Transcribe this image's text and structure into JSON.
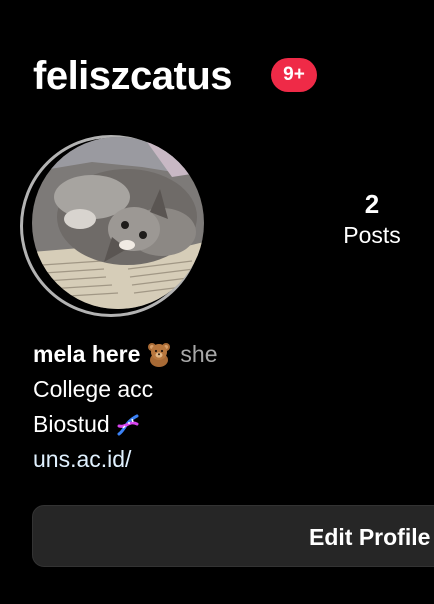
{
  "profile": {
    "username": "feliszcatus",
    "notification_badge": "9+",
    "badge_color": "#ef2a47",
    "avatar": "cat-photo"
  },
  "stats": {
    "posts_count": "2",
    "posts_label": "Posts"
  },
  "bio": {
    "display_name": "mela here",
    "name_emoji": "teddy-bear-icon",
    "pronouns": "she",
    "line1": "College acc",
    "line2": "Biostud",
    "line2_emoji": "dna-icon",
    "link": "uns.ac.id/"
  },
  "actions": {
    "edit_profile_label": "Edit Profile"
  },
  "colors": {
    "background": "#000000",
    "text": "#ffffff",
    "secondary_text": "#a8a8a8",
    "link": "#e0f1ff",
    "button": "#262626"
  }
}
